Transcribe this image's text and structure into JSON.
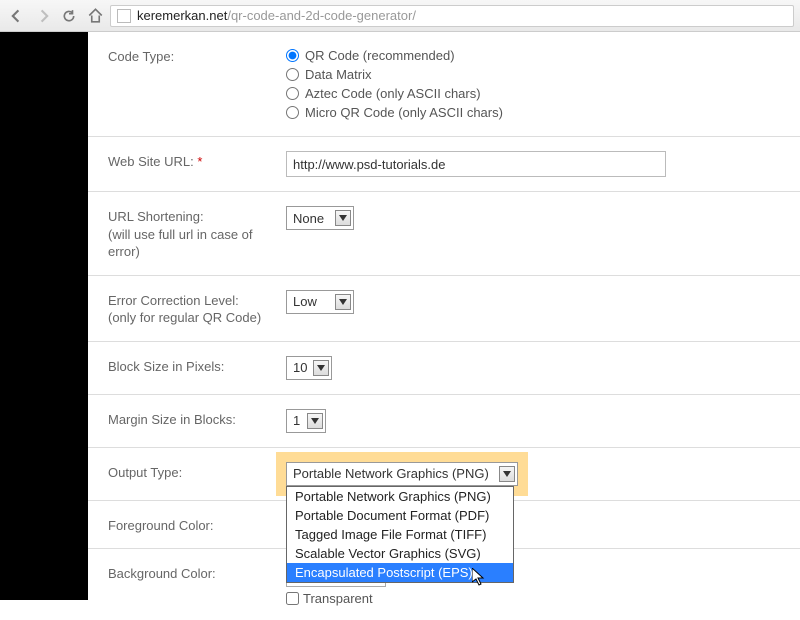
{
  "browser": {
    "url_host": "keremerkan.net",
    "url_path": "/qr-code-and-2d-code-generator/"
  },
  "form": {
    "code_type": {
      "label": "Code Type:",
      "options": [
        "QR Code (recommended)",
        "Data Matrix",
        "Aztec Code (only ASCII chars)",
        "Micro QR Code (only ASCII chars)"
      ],
      "selected_index": 0
    },
    "website_url": {
      "label": "Web Site URL:",
      "required_marker": "*",
      "value": "http://www.psd-tutorials.de"
    },
    "url_shortening": {
      "label": "URL Shortening:",
      "sublabel": "(will use full url in case of error)",
      "value": "None"
    },
    "error_correction": {
      "label": "Error Correction Level:",
      "sublabel": "(only for regular QR Code)",
      "value": "Low"
    },
    "block_size": {
      "label": "Block Size in Pixels:",
      "value": "10"
    },
    "margin_size": {
      "label": "Margin Size in Blocks:",
      "value": "1"
    },
    "output_type": {
      "label": "Output Type:",
      "value": "Portable Network Graphics (PNG)",
      "options": [
        "Portable Network Graphics (PNG)",
        "Portable Document Format (PDF)",
        "Tagged Image File Format (TIFF)",
        "Scalable Vector Graphics (SVG)",
        "Encapsulated Postscript (EPS)"
      ],
      "hover_index": 4
    },
    "foreground_color": {
      "label": "Foreground Color:"
    },
    "background_color": {
      "label": "Background Color:",
      "value": "#FFFFFF",
      "transparent_label": "Transparent"
    }
  }
}
